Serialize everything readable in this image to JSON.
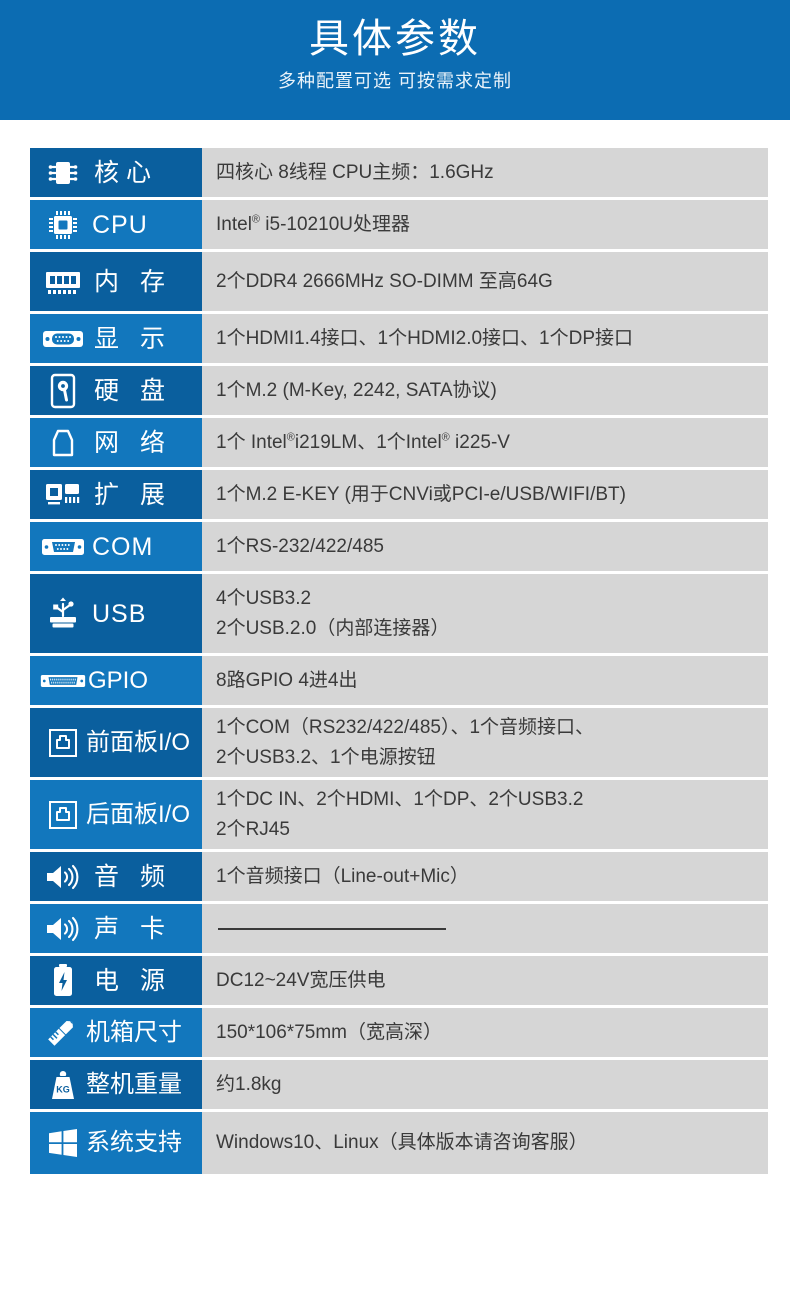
{
  "header": {
    "title": "具体参数",
    "subtitle": "多种配置可选 可按需求定制",
    "background_color": "#0c6cb2"
  },
  "colors": {
    "banner_blue": "#0c6cb2",
    "label_dark_blue": "#0a5f9e",
    "label_light_blue": "#1277bd",
    "value_gray": "#d6d6d6",
    "value_text": "#3a3a3a",
    "divider_white": "#ffffff"
  },
  "spec_table": {
    "rows": [
      {
        "icon": "chip-icon",
        "label": "核心",
        "label_style": "wide",
        "shade": "dark",
        "height": 52,
        "lines": [
          "四核心 8线程 CPU主频：1.6GHz"
        ]
      },
      {
        "icon": "cpu-icon",
        "label": "CPU",
        "label_style": "normal",
        "shade": "light",
        "height": 52,
        "lines": [
          "Intel® i5-10210U处理器"
        ]
      },
      {
        "icon": "memory-icon",
        "label": "内 存",
        "label_style": "wide",
        "shade": "dark",
        "height": 62,
        "lines": [
          "2个DDR4 2666MHz SO-DIMM 至高64G"
        ]
      },
      {
        "icon": "vga-display-icon",
        "label": "显 示",
        "label_style": "wide",
        "shade": "light",
        "height": 52,
        "lines": [
          "1个HDMI1.4接口、1个HDMI2.0接口、1个DP接口"
        ]
      },
      {
        "icon": "harddisk-icon",
        "label": "硬 盘",
        "label_style": "wide",
        "shade": "dark",
        "height": 52,
        "lines": [
          "1个M.2 (M-Key, 2242, SATA协议)"
        ]
      },
      {
        "icon": "network-icon",
        "label": "网 络",
        "label_style": "wide",
        "shade": "light",
        "height": 52,
        "lines": [
          "1个 Intel®i219LM、1个Intel® i225-V"
        ]
      },
      {
        "icon": "expansion-icon",
        "label": "扩 展",
        "label_style": "wide",
        "shade": "dark",
        "height": 52,
        "lines": [
          "1个M.2 E-KEY (用于CNVi或PCI-e/USB/WIFI/BT)"
        ]
      },
      {
        "icon": "com-port-icon",
        "label": "COM",
        "label_style": "normal",
        "shade": "light",
        "height": 52,
        "lines": [
          "1个RS-232/422/485"
        ]
      },
      {
        "icon": "usb-icon",
        "label": "USB",
        "label_style": "normal",
        "shade": "dark",
        "height": 82,
        "lines": [
          "4个USB3.2",
          "2个USB.2.0（内部连接器）"
        ]
      },
      {
        "icon": "gpio-icon",
        "label": "GPIO",
        "label_style": "compact",
        "shade": "light",
        "height": 52,
        "lines": [
          "8路GPIO 4进4出"
        ]
      },
      {
        "icon": "panel-io-icon",
        "label": "前面板I/O",
        "label_style": "tight",
        "shade": "dark",
        "height": 72,
        "lines": [
          "1个COM（RS232/422/485）、1个音频接口、",
          "2个USB3.2、1个电源按钮"
        ]
      },
      {
        "icon": "panel-io-icon",
        "label": "后面板I/O",
        "label_style": "tight",
        "shade": "light",
        "height": 72,
        "lines": [
          "1个DC IN、2个HDMI、1个DP、2个USB3.2",
          "2个RJ45"
        ]
      },
      {
        "icon": "audio-icon",
        "label": "音 频",
        "label_style": "wide",
        "shade": "dark",
        "height": 52,
        "lines": [
          "1个音频接口（Line-out+Mic）"
        ]
      },
      {
        "icon": "audio-icon",
        "label": "声 卡",
        "label_style": "wide",
        "shade": "light",
        "height": 52,
        "lines": [],
        "rule": true
      },
      {
        "icon": "power-icon",
        "label": "电 源",
        "label_style": "wide",
        "shade": "dark",
        "height": 52,
        "lines": [
          "DC12~24V宽压供电"
        ]
      },
      {
        "icon": "ruler-pencil-icon",
        "label": "机箱尺寸",
        "label_style": "tight",
        "shade": "light",
        "height": 52,
        "lines": [
          "150*106*75mm（宽高深）"
        ]
      },
      {
        "icon": "weight-icon",
        "label": "整机重量",
        "label_style": "tight",
        "shade": "dark",
        "height": 52,
        "lines": [
          "约1.8kg"
        ]
      },
      {
        "icon": "windows-icon",
        "label": "系统支持",
        "label_style": "tight",
        "shade": "light",
        "height": 62,
        "lines": [
          "Windows10、Linux（具体版本请咨询客服）"
        ]
      }
    ]
  }
}
